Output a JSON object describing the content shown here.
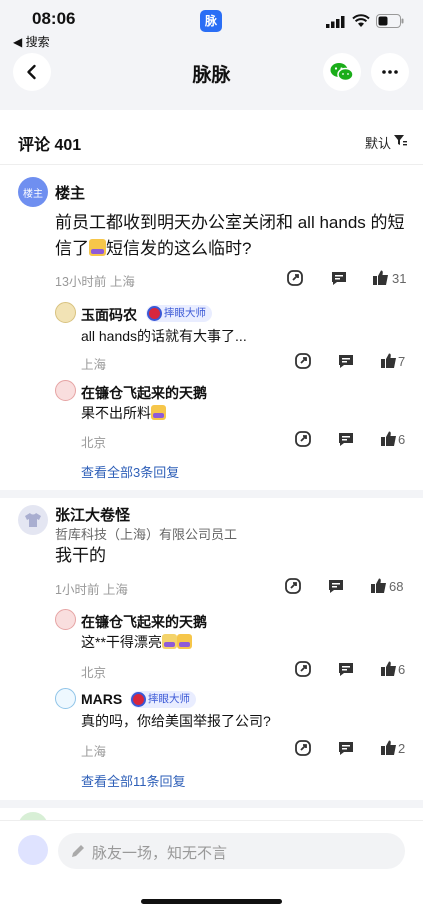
{
  "status_bar": {
    "time": "08:06",
    "back_app": "◀ 搜索",
    "app_badge": "脉"
  },
  "header": {
    "title": "脉脉"
  },
  "comments_header": {
    "count_label": "评论 401",
    "sort_label": "默认"
  },
  "comments": [
    {
      "name": "楼主",
      "avatar_text": "楼主",
      "text_before_emoji": "前员工都收到明天办公室关闭和 all hands 的短信了",
      "text_after_emoji": "短信发的这么临时?",
      "meta": "13小时前 上海",
      "likes": "31",
      "replies": [
        {
          "name": "玉面码农",
          "badge": "摔眼大师",
          "text": "all hands的话就有大事了...",
          "location": "上海",
          "likes": "7"
        },
        {
          "name": "在镰仓飞起来的天鹅",
          "text": "果不出所料",
          "location": "北京",
          "likes": "6"
        }
      ],
      "more_replies": "查看全部3条回复"
    },
    {
      "name": "张江大卷怪",
      "subtitle": "哲库科技（上海）有限公司员工",
      "text": "我干的",
      "meta": "1小时前 上海",
      "likes": "68",
      "replies": [
        {
          "name": "在镰仓飞起来的天鹅",
          "text": "这**干得漂亮",
          "location": "北京",
          "likes": "6"
        },
        {
          "name": "MARS",
          "badge": "摔眼大师",
          "text": "真的吗，你给美国举报了公司?",
          "location": "上海",
          "likes": "2"
        }
      ],
      "more_replies": "查看全部11条回复"
    }
  ],
  "input": {
    "placeholder": "脉友一场，知无不言"
  },
  "icons": {
    "back": "chevron-left-icon",
    "wechat": "wechat-icon",
    "more": "ellipsis-icon",
    "sort": "filter-sort-icon",
    "share": "share-icon",
    "comment": "comment-icon",
    "like": "thumbs-up-icon",
    "pen": "pen-icon"
  },
  "colors": {
    "brand_blue": "#2a6ef5",
    "wechat_green": "#1aad19",
    "link_blue": "#2e5fb8",
    "badge_bg": "#e9edff"
  }
}
